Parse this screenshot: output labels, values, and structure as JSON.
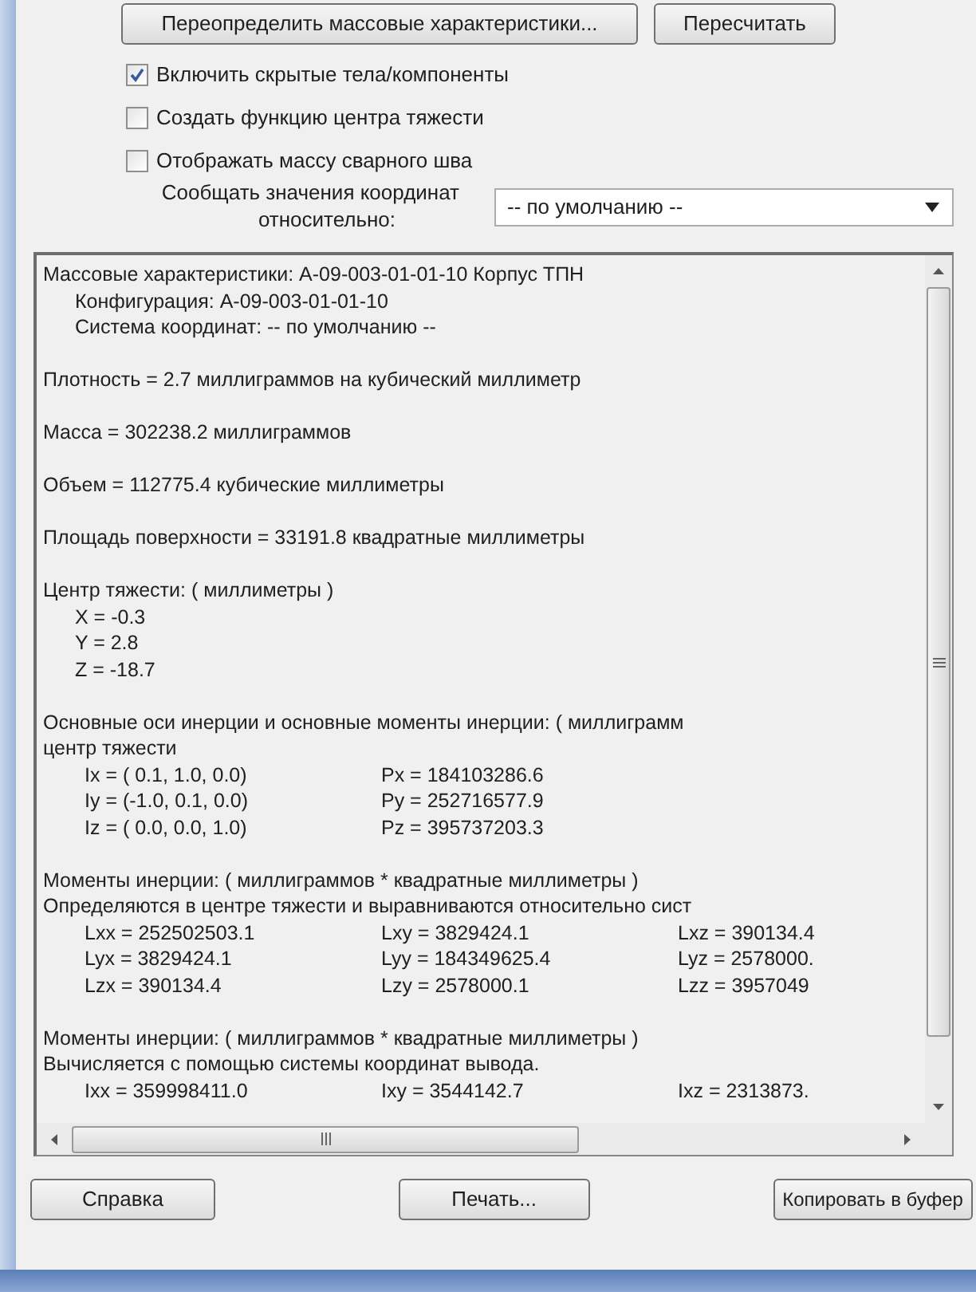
{
  "top_buttons": [
    "Переопределить массовые характеристики...",
    "Пересчитать"
  ],
  "options": [
    {
      "label": "Включить скрытые тела/компоненты",
      "checked": true
    },
    {
      "label": "Создать функцию центра тяжести",
      "checked": false
    },
    {
      "label": "Отображать массу сварного шва",
      "checked": false
    }
  ],
  "report_relative": {
    "label_lines": [
      "Сообщать значения координат",
      "относительно:"
    ],
    "value": "-- по умолчанию --"
  },
  "results": [
    {
      "lines": [
        {
          "kind": "plain",
          "text": "Массовые характеристики: A-09-003-01-01-10 Корпус ТПН"
        },
        {
          "kind": "indented",
          "text": "Конфигурация: A-09-003-01-01-10"
        },
        {
          "kind": "indented",
          "text": "Система координат: -- по умолчанию --"
        }
      ]
    },
    {
      "lines": [
        {
          "kind": "plain",
          "text": "Плотность = 2.7 миллиграммов на кубический миллиметр"
        }
      ]
    },
    {
      "lines": [
        {
          "kind": "plain",
          "text": "Масса = 302238.2 миллиграммов"
        }
      ]
    },
    {
      "lines": [
        {
          "kind": "plain",
          "text": "Объем = 112775.4 кубические миллиметры"
        }
      ]
    },
    {
      "lines": [
        {
          "kind": "plain",
          "text": "Площадь поверхности = 33191.8  квадратные миллиметры"
        }
      ]
    },
    {
      "lines": [
        {
          "kind": "plain",
          "text": "Центр тяжести: ( миллиметры )"
        },
        {
          "kind": "indented",
          "text": "X = -0.3"
        },
        {
          "kind": "indented",
          "text": "Y = 2.8"
        },
        {
          "kind": "indented",
          "text": "Z = -18.7"
        }
      ]
    },
    {
      "lines": [
        {
          "kind": "plain",
          "text": "Основные оси инерции и основные моменты инерции: ( миллиграмм"
        },
        {
          "kind": "plain",
          "text": "центр тяжести"
        },
        {
          "kind": "row",
          "cells": [
            "Ix = ( 0.1,  1.0,  0.0)",
            "Px = 184103286.6"
          ]
        },
        {
          "kind": "row",
          "cells": [
            "Iy = (-1.0,  0.1,  0.0)",
            "Py = 252716577.9"
          ]
        },
        {
          "kind": "row",
          "cells": [
            "Iz = ( 0.0,  0.0,  1.0)",
            "Pz = 395737203.3"
          ]
        }
      ]
    },
    {
      "lines": [
        {
          "kind": "plain",
          "text": "Моменты инерции: ( миллиграммов *  квадратные миллиметры )"
        },
        {
          "kind": "plain",
          "text": "Определяются в центре тяжести и выравниваются относительно сист"
        },
        {
          "kind": "row",
          "cells": [
            "Lxx = 252502503.1",
            "Lxy = 3829424.1",
            "Lxz = 390134.4"
          ]
        },
        {
          "kind": "row",
          "cells": [
            "Lyx = 3829424.1",
            "Lyy = 184349625.4",
            "Lyz = 2578000."
          ]
        },
        {
          "kind": "row",
          "cells": [
            "Lzx = 390134.4",
            "Lzy = 2578000.1",
            "Lzz = 3957049"
          ]
        }
      ]
    },
    {
      "lines": [
        {
          "kind": "plain",
          "text": "Моменты инерции: ( миллиграммов *  квадратные миллиметры )"
        },
        {
          "kind": "plain",
          "text": "Вычисляется с помощью системы координат вывода."
        },
        {
          "kind": "row",
          "cells": [
            "Ixx = 359998411.0",
            "Ixy = 3544142.7",
            "Ixz = 2313873."
          ]
        }
      ]
    }
  ],
  "bottom_buttons": [
    "Справка",
    "Печать...",
    "Копировать в буфер"
  ]
}
